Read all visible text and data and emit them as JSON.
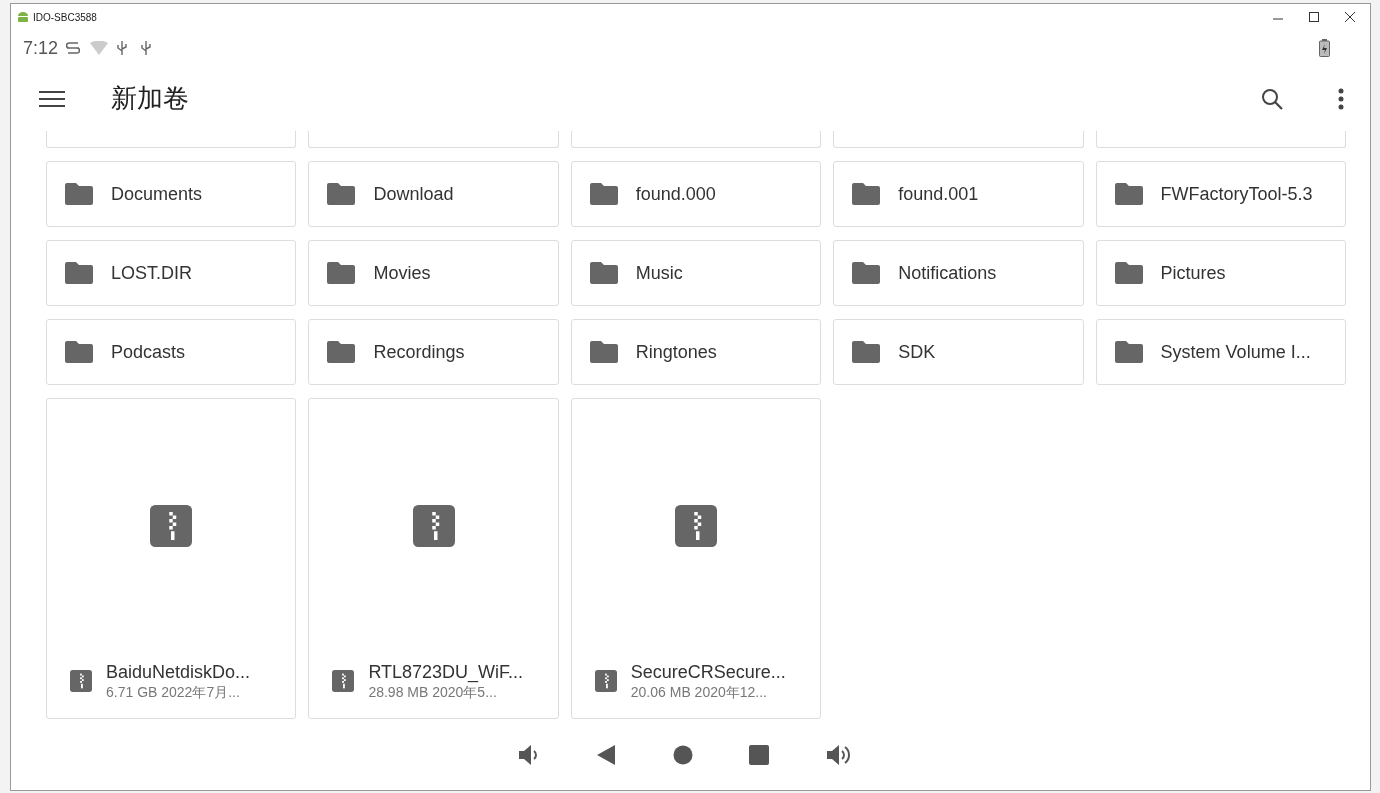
{
  "window": {
    "title": "IDO-SBC3588"
  },
  "status_bar": {
    "time": "7:12"
  },
  "app_bar": {
    "title": "新加卷"
  },
  "folders": [
    {
      "name": "Documents"
    },
    {
      "name": "Download"
    },
    {
      "name": "found.000"
    },
    {
      "name": "found.001"
    },
    {
      "name": "FWFactoryTool-5.3"
    },
    {
      "name": "LOST.DIR"
    },
    {
      "name": "Movies"
    },
    {
      "name": "Music"
    },
    {
      "name": "Notifications"
    },
    {
      "name": "Pictures"
    },
    {
      "name": "Podcasts"
    },
    {
      "name": "Recordings"
    },
    {
      "name": "Ringtones"
    },
    {
      "name": "SDK"
    },
    {
      "name": "System Volume I..."
    }
  ],
  "files": [
    {
      "name": "BaiduNetdiskDo...",
      "details": "6.71 GB 2022年7月..."
    },
    {
      "name": "RTL8723DU_WiF...",
      "details": "28.98 MB 2020年5..."
    },
    {
      "name": "SecureCRSecure...",
      "details": "20.06 MB 2020年12..."
    }
  ]
}
